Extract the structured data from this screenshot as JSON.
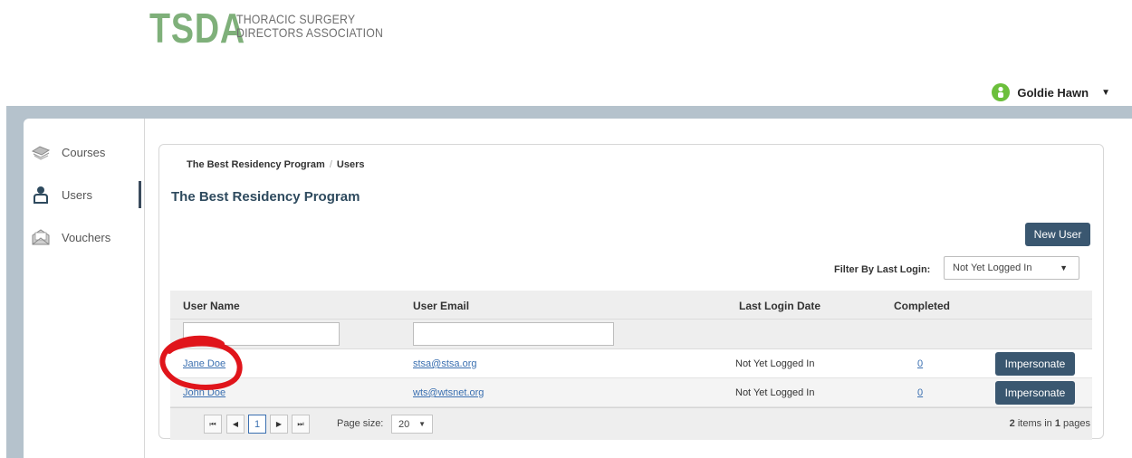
{
  "logo": {
    "mark": "TSDA",
    "line1": "THORACIC SURGERY",
    "line2": "DIRECTORS ASSOCIATION"
  },
  "user": {
    "name": "Goldie Hawn"
  },
  "sidebar": {
    "items": [
      {
        "label": "Courses",
        "icon": "courses-icon"
      },
      {
        "label": "Users",
        "icon": "user-icon",
        "active": true
      },
      {
        "label": "Vouchers",
        "icon": "voucher-icon"
      }
    ]
  },
  "breadcrumb": {
    "program": "The Best Residency Program",
    "sep": "/",
    "current": "Users"
  },
  "page": {
    "title": "The Best Residency Program"
  },
  "buttons": {
    "new_user": "New User"
  },
  "filter": {
    "label": "Filter By Last Login:",
    "selected": "Not Yet Logged In"
  },
  "grid": {
    "columns": [
      "User Name",
      "User Email",
      "Last Login Date",
      "Completed"
    ],
    "rows": [
      {
        "name": "Jane Doe",
        "email": "stsa@stsa.org",
        "last_login": "Not Yet Logged In",
        "completed": "0",
        "action": "Impersonate"
      },
      {
        "name": "John Doe",
        "email": "wts@wtsnet.org",
        "last_login": "Not Yet Logged In",
        "completed": "0",
        "action": "Impersonate"
      }
    ]
  },
  "pager": {
    "current_page": "1",
    "page_size_label": "Page size:",
    "page_size": "20",
    "items_count": "2",
    "items_mid": "items in",
    "pages_count": "1",
    "pages_word": "pages"
  },
  "colors": {
    "accent": "#3a5770",
    "logo": "#7fb07a",
    "link": "#3a6fb0",
    "annotation": "#e0151b"
  }
}
